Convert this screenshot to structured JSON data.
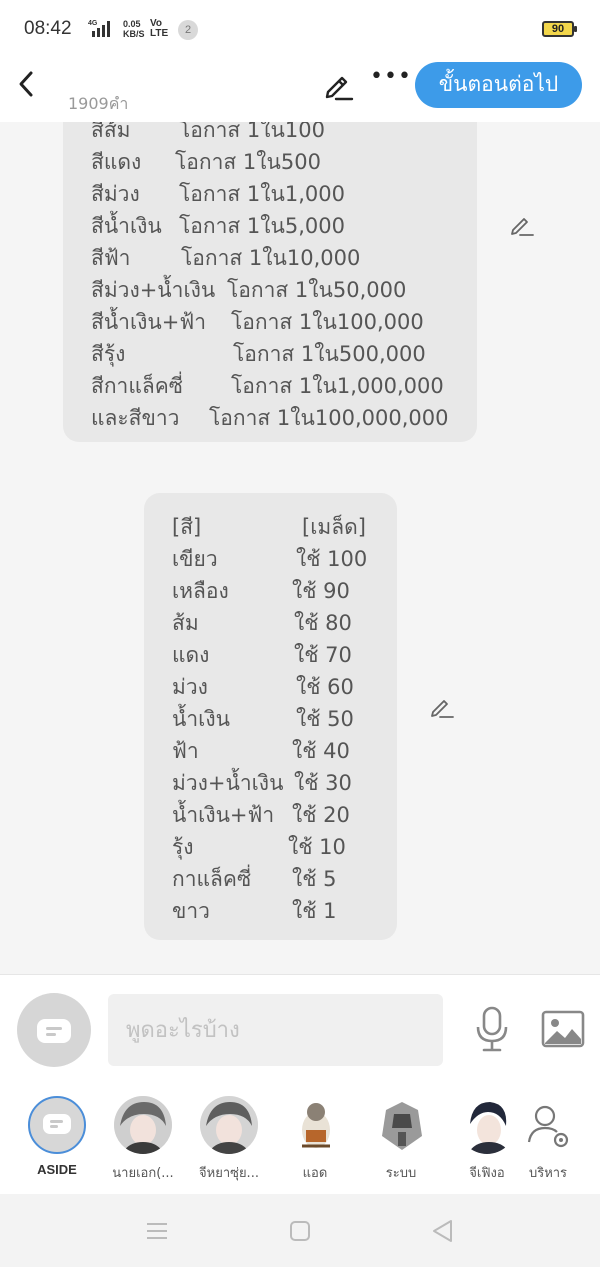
{
  "status_bar": {
    "time": "08:42",
    "net_type": "4G",
    "speed": "0.05",
    "speed_unit": "KB/S",
    "volte_top": "Vo",
    "volte_bottom": "LTE",
    "notification_count": "2",
    "battery": "90"
  },
  "top_bar": {
    "word_count": "1909คำ",
    "next_label": "ขั้นตอนต่อไป"
  },
  "bubble1": {
    "lines": [
      {
        "name": "สีส้ม",
        "chance": "โอกาส 1ใน100"
      },
      {
        "name": "สีแดง",
        "chance": "โอกาส 1ใน500"
      },
      {
        "name": "สีม่วง",
        "chance": "โอกาส 1ใน1,000"
      },
      {
        "name": "สีน้ำเงิน",
        "chance": "โอกาส 1ใน5,000"
      },
      {
        "name": "สีฟ้า",
        "chance": "โอกาส 1ใน10,000"
      },
      {
        "name": "สีม่วง+น้ำเงิน",
        "chance": "โอกาส 1ใน50,000"
      },
      {
        "name": "สีน้ำเงิน+ฟ้า",
        "chance": "โอกาส 1ใน100,000"
      },
      {
        "name": "สีรุ้ง",
        "chance": "โอกาส 1ใน500,000"
      },
      {
        "name": "สีกาแล็คซี่",
        "chance": "โอกาส 1ใน1,000,000"
      },
      {
        "name": "และสีขาว",
        "chance": "โอกาส 1ใน100,000,000"
      }
    ]
  },
  "bubble2": {
    "header": {
      "color": "[สี]",
      "seeds": "[เมล็ด]"
    },
    "rows": [
      {
        "color": "เขียว",
        "seeds": "ใช้ 100"
      },
      {
        "color": "เหลือง",
        "seeds": "ใช้  90"
      },
      {
        "color": "ส้ม",
        "seeds": "ใช้  80"
      },
      {
        "color": "แดง",
        "seeds": "ใช้  70"
      },
      {
        "color": "ม่วง",
        "seeds": "ใช้ 60"
      },
      {
        "color": "น้ำเงิน",
        "seeds": "ใช้ 50"
      },
      {
        "color": "ฟ้า",
        "seeds": "ใช้ 40"
      },
      {
        "color": "ม่วง+น้ำเงิน",
        "seeds": "ใช้ 30"
      },
      {
        "color": "น้ำเงิน+ฟ้า",
        "seeds": "ใช้  20"
      },
      {
        "color": "รุ้ง",
        "seeds": "ใช้  10"
      },
      {
        "color": "กาแล็คซี่",
        "seeds": "ใช้ 5"
      },
      {
        "color": "ขาว",
        "seeds": "ใช้ 1"
      }
    ]
  },
  "input": {
    "placeholder": "พูดอะไรบ้าง"
  },
  "characters": [
    {
      "name": "ASIDE"
    },
    {
      "name": "นายเอก(..."
    },
    {
      "name": "จีหยาซุ่ย..."
    },
    {
      "name": "แอด"
    },
    {
      "name": "ระบบ"
    },
    {
      "name": "จีเฟิงอ"
    },
    {
      "name": "บริหาร"
    }
  ],
  "colors": {
    "accent": "#3d9be9",
    "bubble": "#e8e8e8",
    "background": "#f5f5f5"
  },
  "icons": [
    "back-arrow-icon",
    "pencil-icon",
    "more-icon",
    "edit-icon",
    "aside-chat-icon",
    "microphone-icon",
    "image-icon",
    "manage-user-icon",
    "menu-icon",
    "home-square-icon",
    "back-triangle-icon"
  ]
}
